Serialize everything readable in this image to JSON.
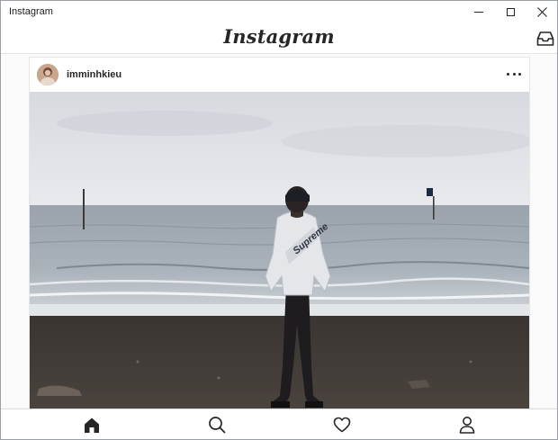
{
  "window": {
    "title": "Instagram"
  },
  "header": {
    "wordmark": "Instagram",
    "inbox_icon": "inbox-tray-icon"
  },
  "post": {
    "username": "imminhkieu",
    "avatar_color": "#b8927a",
    "more_icon": "more-dots-icon",
    "photo_text": "Supreme"
  },
  "bottom_nav": {
    "items": [
      {
        "icon": "home-icon",
        "active": true
      },
      {
        "icon": "search-icon",
        "active": false
      },
      {
        "icon": "heart-icon",
        "active": false
      },
      {
        "icon": "profile-icon",
        "active": false
      }
    ]
  },
  "colors": {
    "text": "#262626",
    "border": "#dbdbdb",
    "background": "#fafafa"
  }
}
